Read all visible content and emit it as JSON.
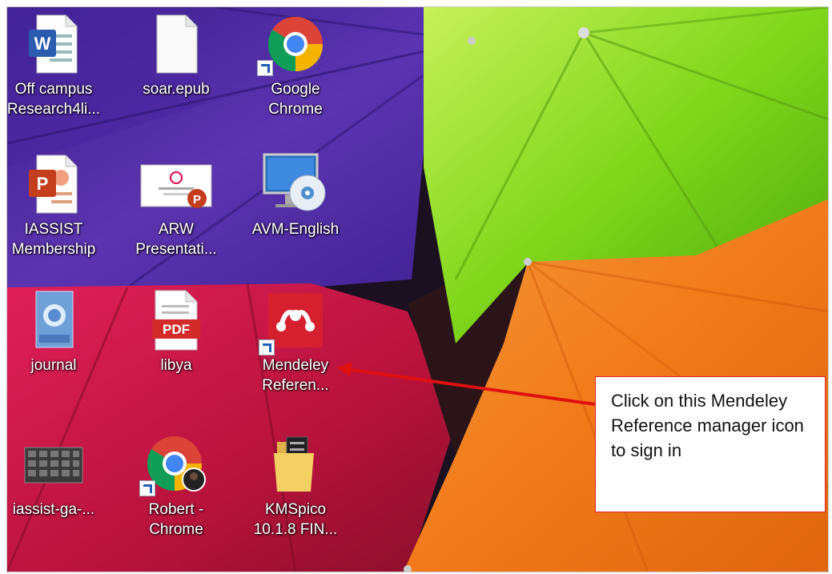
{
  "desktop": {
    "icons": [
      {
        "id": "off-campus",
        "label": "Off campus\nResearch4li...",
        "type": "word-document"
      },
      {
        "id": "soar",
        "label": "soar.epub",
        "type": "blank-file"
      },
      {
        "id": "google-chrome",
        "label": "Google\nChrome",
        "type": "chrome",
        "shortcut": true
      },
      {
        "id": "iassist",
        "label": "IASSIST\nMembership",
        "type": "powerpoint-document"
      },
      {
        "id": "arw",
        "label": "ARW\nPresentati...",
        "type": "powerpoint-slide-thumbnail"
      },
      {
        "id": "avm",
        "label": "AVM-English",
        "type": "monitor-disc"
      },
      {
        "id": "journal",
        "label": "journal",
        "type": "image-thumbnail"
      },
      {
        "id": "libya",
        "label": "libya",
        "type": "pdf-document",
        "badge": "PDF"
      },
      {
        "id": "mendeley",
        "label": "Mendeley\nReferen...",
        "type": "mendeley",
        "shortcut": true
      },
      {
        "id": "iassist-ga",
        "label": "iassist-ga-...",
        "type": "image-thumbnail"
      },
      {
        "id": "robert-chrome",
        "label": "Robert -\nChrome",
        "type": "chrome-profile",
        "shortcut": true
      },
      {
        "id": "kmspico",
        "label": "KMSpico\n10.1.8 FIN...",
        "type": "folder"
      }
    ]
  },
  "callout": {
    "text": "Click on this Mendeley Reference manager icon to sign in",
    "border_color": "#e02020",
    "arrow_color": "#e01010"
  },
  "colors": {
    "wallpaper_purple": "#5a2fa8",
    "wallpaper_pink": "#d81b4a",
    "wallpaper_green": "#8ee01e",
    "wallpaper_orange": "#f3761c",
    "mendeley_red": "#d6202f",
    "pdf_red": "#d32a2a"
  }
}
